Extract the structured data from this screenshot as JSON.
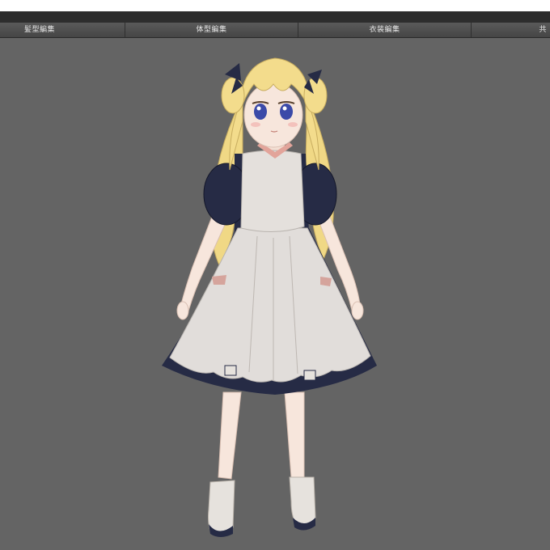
{
  "editor": {
    "tabs": [
      {
        "label": "髪型編集"
      },
      {
        "label": "体型編集"
      },
      {
        "label": "衣装編集"
      },
      {
        "label": "共"
      }
    ]
  },
  "viewport": {
    "background": "#646464",
    "colors": {
      "hair": "#f3dc8c",
      "skin": "#f7e6dc",
      "dress": "#262b45",
      "apron": "#e1ddda",
      "eyes": "#3b4aa8"
    }
  }
}
